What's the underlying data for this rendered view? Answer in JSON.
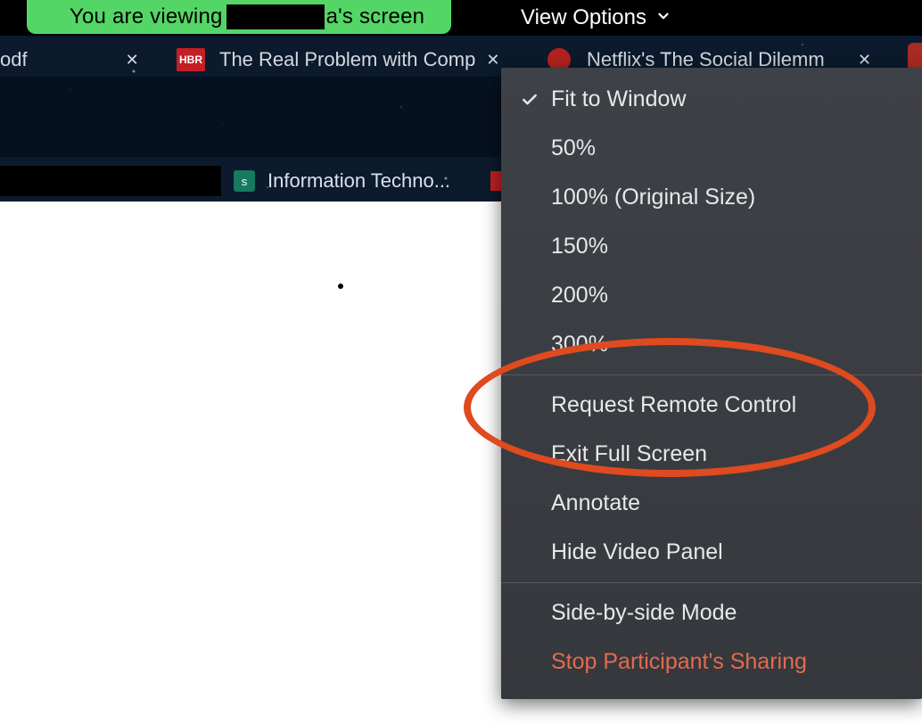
{
  "banner": {
    "prefix": "You are viewing ",
    "suffix": "a's screen"
  },
  "viewOptionsButton": "View Options",
  "tabs": {
    "row1": {
      "tab1": "odf",
      "tab2": "The Real Problem with Comp",
      "tab2_badge": "HBR",
      "tab3": "Netflix's The Social Dilemm"
    },
    "row2": {
      "tab2": "Information Techno...",
      "tab2_badge": "s"
    }
  },
  "menu": {
    "section1": [
      {
        "label": "Fit to Window",
        "checked": true
      },
      {
        "label": "50%",
        "checked": false
      },
      {
        "label": "100% (Original Size)",
        "checked": false
      },
      {
        "label": "150%",
        "checked": false
      },
      {
        "label": "200%",
        "checked": false
      },
      {
        "label": "300%",
        "checked": false
      }
    ],
    "section2": [
      {
        "label": "Request Remote Control"
      },
      {
        "label": "Exit Full Screen"
      },
      {
        "label": "Annotate"
      },
      {
        "label": "Hide Video Panel"
      }
    ],
    "section3": [
      {
        "label": "Side-by-side Mode",
        "danger": false
      },
      {
        "label": "Stop Participant's Sharing",
        "danger": true
      }
    ]
  }
}
